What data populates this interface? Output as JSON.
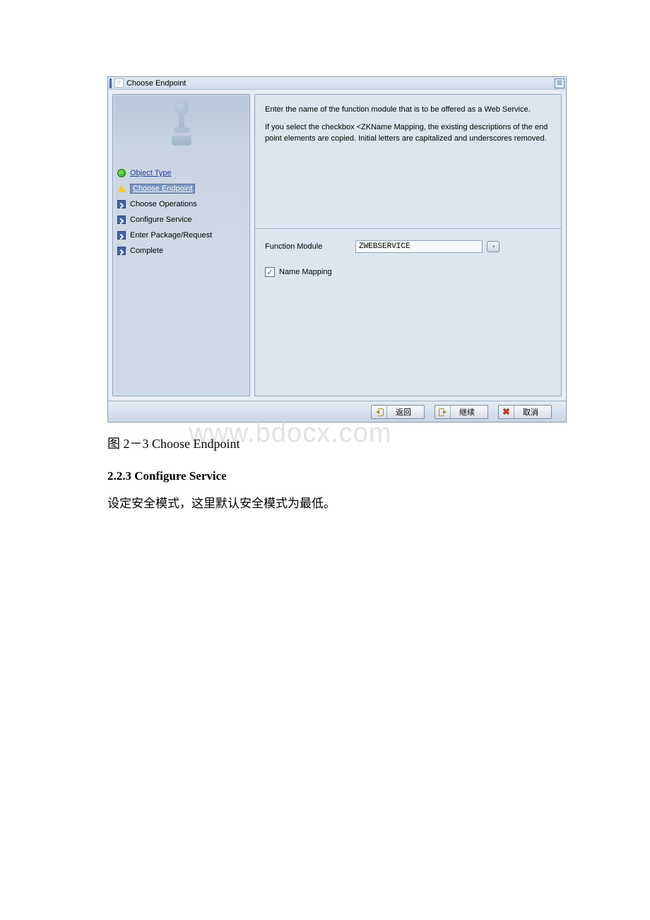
{
  "window": {
    "title": "Choose Endpoint"
  },
  "sidebar": {
    "items": [
      {
        "label": "Object Type",
        "state": "done-link"
      },
      {
        "label": "Choose Endpoint",
        "state": "active"
      },
      {
        "label": "Choose Operations",
        "state": "todo"
      },
      {
        "label": "Configure Service",
        "state": "todo"
      },
      {
        "label": "Enter Package/Request",
        "state": "todo"
      },
      {
        "label": "Complete",
        "state": "todo"
      }
    ]
  },
  "content": {
    "para1": "Enter the name of the function module that is to be offered as a Web Service.",
    "para2": "If you select the checkbox <ZKName Mapping, the existing descriptions of the end point elements are copied. Initial letters are capitalized and underscores removed.",
    "function_module_label": "Function Module",
    "function_module_value": "ZWEBSERVICE",
    "name_mapping_label": "Name Mapping",
    "name_mapping_checked": true
  },
  "buttons": {
    "back": "返回",
    "continue": "继续",
    "cancel": "取消"
  },
  "caption": "图 2－3 Choose Endpoint",
  "watermark": "www.bdocx.com",
  "section_heading": "2.2.3 Configure Service",
  "body_text": "设定安全模式，这里默认安全模式为最低。"
}
